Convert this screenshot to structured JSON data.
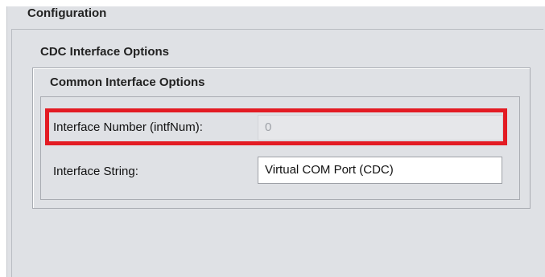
{
  "configuration": {
    "title": "Configuration"
  },
  "cdc_options": {
    "title": "CDC Interface Options"
  },
  "common_options": {
    "title": "Common Interface Options",
    "interface_number": {
      "label": "Interface Number (intfNum):",
      "value": "0"
    },
    "interface_string": {
      "label": "Interface String:",
      "value": "Virtual COM Port (CDC)"
    }
  },
  "colors": {
    "panel_background": "#dfe1e5",
    "highlight_border": "#e31b23",
    "disabled_text": "#9ea1a7"
  }
}
